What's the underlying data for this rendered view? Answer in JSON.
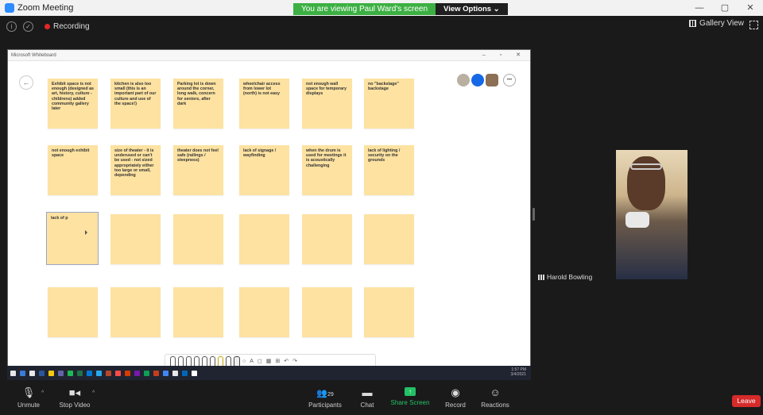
{
  "window": {
    "title": "Zoom Meeting",
    "controls": [
      "—",
      "▢",
      "✕"
    ]
  },
  "share_banner": {
    "message": "You are viewing Paul Ward's screen",
    "options_label": "View Options ⌄"
  },
  "top_bar": {
    "recording_label": "Recording",
    "gallery_view_label": "Gallery View"
  },
  "whiteboard": {
    "title": "Microsoft Whiteboard",
    "window_controls": "– ▫ ✕",
    "back_label": "←",
    "avatars_more": "•••",
    "notes": [
      "Exhibit space is not enough (designed as art, history, culture - childrens) added community gallery later",
      "kitchen is also too small (this is an important part of our culture and use of the space!)",
      "Parking lot is down around the corner, long walk, concern for seniors, after dark",
      "wheelchair access from lower lot (north) is not easy",
      "not enough wall space for temporary displays",
      "no \"backstage\" backstage",
      "not enough exhibit space",
      "size of theater - it is underused or can't be used - not sized appropriately either too large or small, depending",
      "theater does not feel safe (railings / steepness)",
      "lack of signage / wayfinding",
      "when the drum is used for meetings it is acoustically challenging",
      "lack of lighting / security on the grounds",
      "lack of p",
      "",
      "",
      "",
      "",
      "",
      "",
      "",
      "",
      "",
      "",
      ""
    ],
    "toolbar_symbols": [
      "A",
      "◻",
      "▦",
      "⊞",
      "↶",
      "↷"
    ]
  },
  "taskbar": {
    "colors": [
      "#e8e8e8",
      "#3a7bd5",
      "#e8e8e8",
      "#2b579a",
      "#f2c811",
      "#6264a7",
      "#1db954",
      "#217346",
      "#0078d4",
      "#28a8ea",
      "#b7472a",
      "#ff4b4b",
      "#d83b01",
      "#7719aa",
      "#0f9d58",
      "#c43e1c",
      "#4285f4",
      "#e8e8e8",
      "#0067b8",
      "#ffffff"
    ],
    "tray_time": "1:57 PM",
    "tray_date": "3/4/2021"
  },
  "participant": {
    "name": "Harold Bowling"
  },
  "controls": {
    "unmute": "Unmute",
    "stop_video": "Stop Video",
    "participants": "Participants",
    "participants_count": "29",
    "chat": "Chat",
    "share_screen": "Share Screen",
    "record": "Record",
    "reactions": "Reactions",
    "leave": "Leave"
  }
}
